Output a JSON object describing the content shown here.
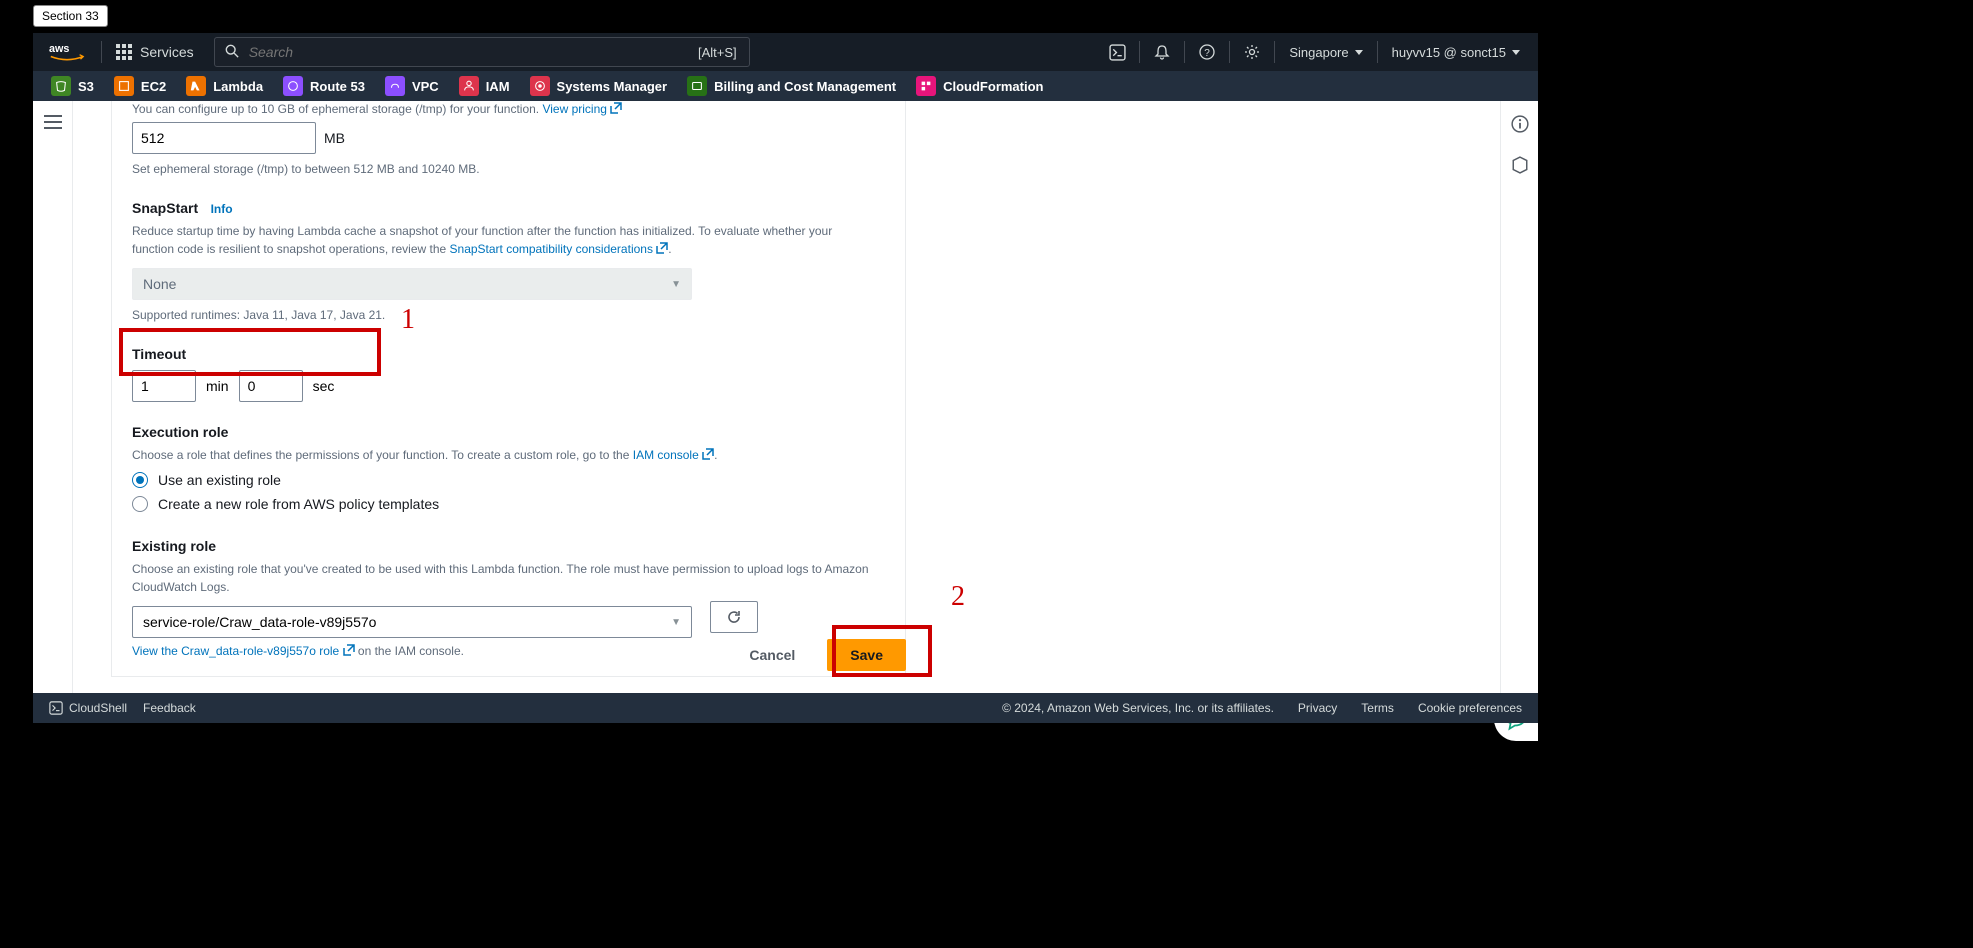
{
  "tab_label": "Section 33",
  "header": {
    "services_label": "Services",
    "search_placeholder": "Search",
    "search_hint": "[Alt+S]",
    "region": "Singapore",
    "user": "huyvv15 @ sonct15"
  },
  "favorites": [
    {
      "label": "S3",
      "color": "#3f8624"
    },
    {
      "label": "EC2",
      "color": "#ed7100"
    },
    {
      "label": "Lambda",
      "color": "#ed7100"
    },
    {
      "label": "Route 53",
      "color": "#8c4fff"
    },
    {
      "label": "VPC",
      "color": "#8c4fff"
    },
    {
      "label": "IAM",
      "color": "#dd344c"
    },
    {
      "label": "Systems Manager",
      "color": "#dd344c"
    },
    {
      "label": "Billing and Cost Management",
      "color": "#277116"
    },
    {
      "label": "CloudFormation",
      "color": "#e7157b"
    }
  ],
  "ephemeral": {
    "desc_prefix": "You can configure up to 10 GB of ephemeral storage (/tmp) for your function. ",
    "view_pricing": "View pricing",
    "value": "512",
    "unit": "MB",
    "helper": "Set ephemeral storage (/tmp) to between 512 MB and 10240 MB."
  },
  "snapstart": {
    "title": "SnapStart",
    "info": "Info",
    "desc_1": "Reduce startup time by having Lambda cache a snapshot of your function after the function has initialized. To evaluate whether your function code is resilient to snapshot operations, review the ",
    "link": "SnapStart compatibility considerations",
    "value": "None",
    "helper": "Supported runtimes: Java 11, Java 17, Java 21."
  },
  "timeout": {
    "title": "Timeout",
    "min_value": "1",
    "min_label": "min",
    "sec_value": "0",
    "sec_label": "sec"
  },
  "execrole": {
    "title": "Execution role",
    "desc": "Choose a role that defines the permissions of your function. To create a custom role, go to the ",
    "iam_link": "IAM console",
    "opt_existing": "Use an existing role",
    "opt_create": "Create a new role from AWS policy templates"
  },
  "existingrole": {
    "title": "Existing role",
    "desc": "Choose an existing role that you've created to be used with this Lambda function. The role must have permission to upload logs to Amazon CloudWatch Logs.",
    "value": "service-role/Craw_data-role-v89j557o",
    "view_link": "View the Craw_data-role-v89j557o role",
    "view_suffix": " on the IAM console."
  },
  "buttons": {
    "cancel": "Cancel",
    "save": "Save"
  },
  "footer": {
    "cloudshell": "CloudShell",
    "feedback": "Feedback",
    "copyright": "© 2024, Amazon Web Services, Inc. or its affiliates.",
    "privacy": "Privacy",
    "terms": "Terms",
    "cookies": "Cookie preferences"
  },
  "annotations": {
    "one": "1",
    "two": "2"
  }
}
